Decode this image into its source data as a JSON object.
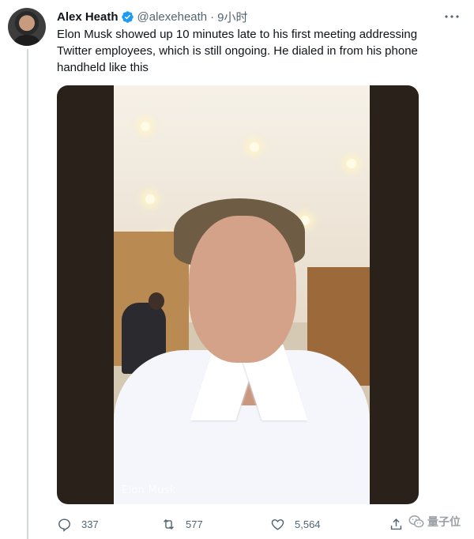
{
  "tweet": {
    "author_name": "Alex Heath",
    "author_handle": "@alexeheath",
    "separator": "·",
    "timestamp": "9小时",
    "text": "Elon Musk showed up 10 minutes late to his first meeting addressing Twitter employees, which is still ongoing. He dialed in from his phone handheld like this",
    "media_caption": "Elon Musk"
  },
  "actions": {
    "reply_count": "337",
    "retweet_count": "577",
    "like_count": "5,564"
  },
  "watermark": {
    "text": "量子位"
  },
  "icons": [
    "verified-badge-icon",
    "more-options-icon",
    "reply-icon",
    "retweet-icon",
    "like-icon",
    "share-icon",
    "wechat-icon"
  ],
  "colors": {
    "verified": "#1d9bf0",
    "text": "#0f1419",
    "secondary": "#536471",
    "thread_line": "#cfd9de"
  }
}
